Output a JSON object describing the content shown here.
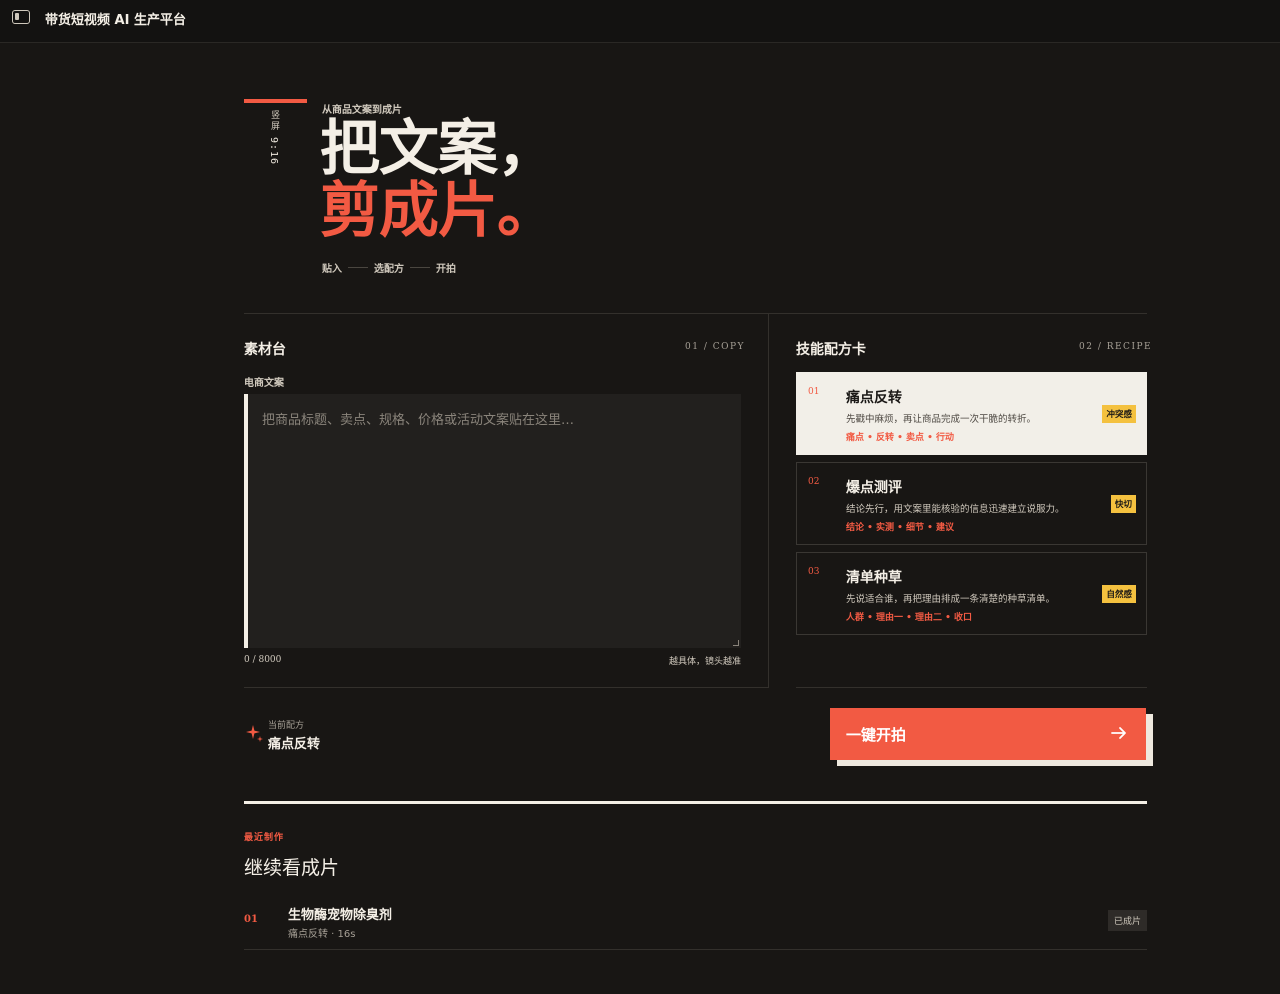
{
  "app": {
    "title": "带货短视频 AI 生产平台"
  },
  "hero": {
    "vertical_label": "竖屏",
    "ratio": "9:16",
    "eyebrow": "从商品文案到成片",
    "headline_line1": "把文案，",
    "headline_line2": "剪成片。",
    "steps": [
      "贴入",
      "选配方",
      "开拍"
    ]
  },
  "material": {
    "title": "素材台",
    "code": "01 / COPY",
    "field_label": "电商文案",
    "placeholder": "把商品标题、卖点、规格、价格或活动文案贴在这里…",
    "value": "",
    "counter": "0 / 8000",
    "hint": "越具体，镜头越准"
  },
  "recipes": {
    "title": "技能配方卡",
    "code": "02 / RECIPE",
    "items": [
      {
        "num": "01",
        "name": "痛点反转",
        "desc": "先戳中麻烦，再让商品完成一次干脆的转折。",
        "tags": "痛点 • 反转 • 卖点 • 行动",
        "badge": "冲突感",
        "active": true
      },
      {
        "num": "02",
        "name": "爆点测评",
        "desc": "结论先行，用文案里能核验的信息迅速建立说服力。",
        "tags": "结论 • 实测 • 细节 • 建议",
        "badge": "快切",
        "active": false
      },
      {
        "num": "03",
        "name": "清单种草",
        "desc": "先说适合谁，再把理由排成一条清楚的种草清单。",
        "tags": "人群 • 理由一 • 理由二 • 收口",
        "badge": "自然感",
        "active": false
      }
    ]
  },
  "current": {
    "label": "当前配方",
    "name": "痛点反转"
  },
  "start_button": {
    "label": "一键开拍"
  },
  "recent": {
    "eyebrow": "最近制作",
    "title": "继续看成片",
    "rows": [
      {
        "num": "01",
        "title": "生物酶宠物除臭剂",
        "meta": "痛点反转 · 16s",
        "status": "已成片"
      }
    ]
  },
  "colors": {
    "accent": "#f25a43",
    "badge": "#f4c13f",
    "bg": "#181614",
    "ink": "#f4efe6"
  }
}
